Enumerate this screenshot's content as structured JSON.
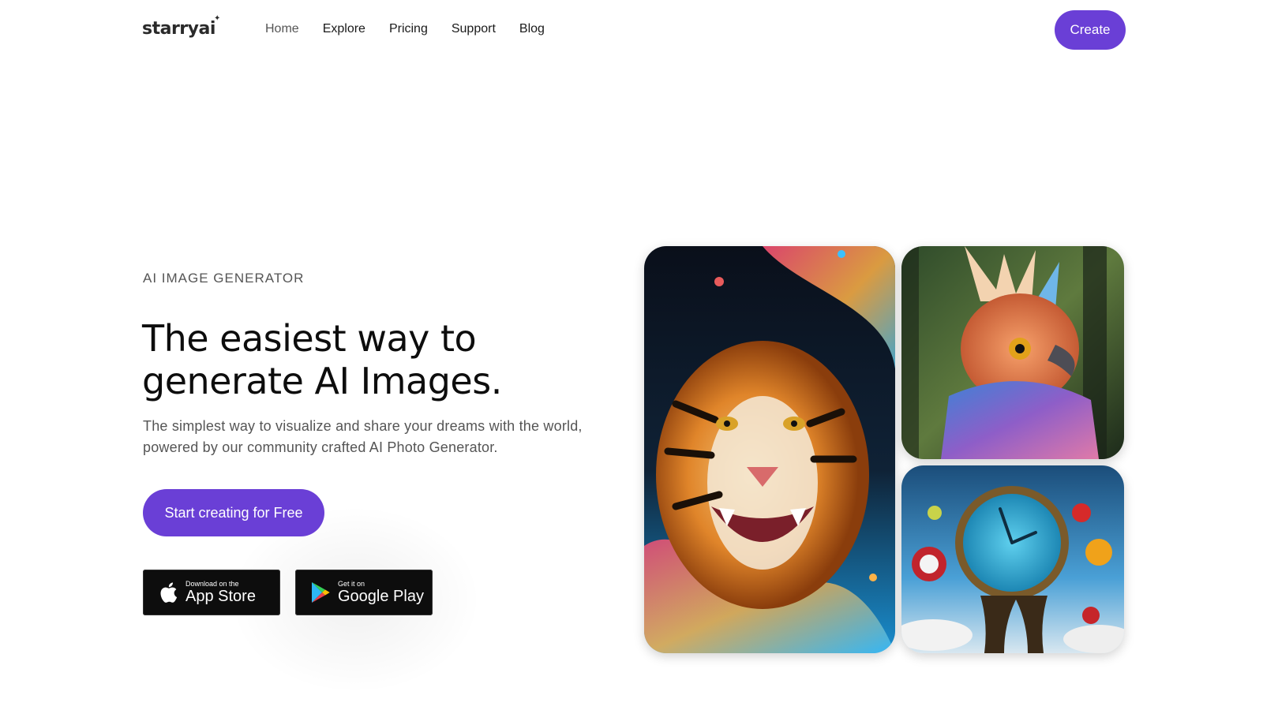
{
  "nav": {
    "logo": "starryai",
    "links": [
      "Home",
      "Explore",
      "Pricing",
      "Support",
      "Blog"
    ],
    "create_label": "Create"
  },
  "hero": {
    "eyebrow": "AI IMAGE GENERATOR",
    "headline_line1": "The easiest way to",
    "headline_line2": "generate AI Images.",
    "subtext": "The simplest way to visualize and share your dreams with the world, powered by our community crafted AI Photo Generator.",
    "cta_label": "Start creating for Free"
  },
  "stores": {
    "apple_small": "Download on the",
    "apple_big": "App Store",
    "google_small": "Get it on",
    "google_big": "Google Play"
  },
  "gallery": [
    {
      "name": "tiger-image"
    },
    {
      "name": "bird-image"
    },
    {
      "name": "clock-image"
    }
  ],
  "colors": {
    "accent": "#6a3fd6",
    "text_dark": "#0d0d0d",
    "text_muted": "#555555"
  }
}
